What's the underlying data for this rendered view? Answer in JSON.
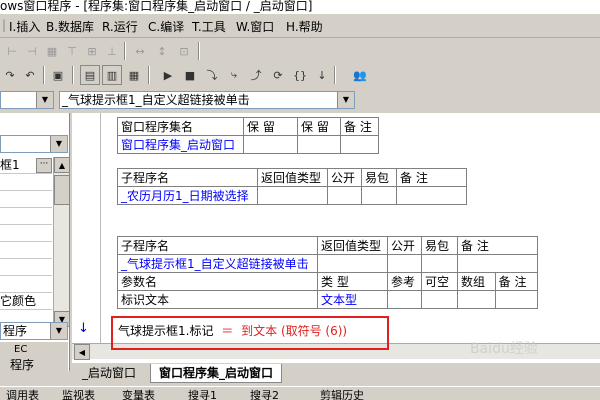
{
  "window": {
    "title": "ows窗口程序 - [程序集:窗口程序集_启动窗口 / _启动窗口]"
  },
  "menu": {
    "items": [
      "I.插入",
      "B.数据库",
      "R.运行",
      "C.编译",
      "T.工具",
      "W.窗口",
      "H.帮助"
    ]
  },
  "toolbar": {
    "combo_left": "",
    "combo_main": "_气球提示框1_自定义超链接被单击"
  },
  "left_panel": {
    "combo_top": "",
    "row_selected": "框1",
    "row_dots": "···",
    "row_color": "它颜色",
    "combo_bottom": "程序",
    "tab_ec": "EC",
    "tab_program": "程序"
  },
  "editor": {
    "table1": {
      "headers": [
        "窗口程序集名",
        "保 留",
        "保 留",
        "备 注"
      ],
      "row": [
        "窗口程序集_启动窗口",
        "",
        "",
        ""
      ]
    },
    "table2": {
      "headers": [
        "子程序名",
        "返回值类型",
        "公开",
        "易包",
        "备 注"
      ],
      "row": [
        "_农历月历1_日期被选择",
        "",
        "",
        "",
        ""
      ]
    },
    "table3": {
      "headers": [
        "子程序名",
        "返回值类型",
        "公开",
        "易包",
        "备 注"
      ],
      "row": [
        "_气球提示框1_自定义超链接被单击",
        "",
        "",
        "",
        ""
      ],
      "param_headers": [
        "参数名",
        "类 型",
        "参考",
        "可空",
        "数组",
        "备 注"
      ],
      "param_row": [
        "标识文本",
        "文本型",
        "",
        "",
        "",
        ""
      ]
    },
    "code": {
      "object": "气球提示框1.标记",
      "op": "＝",
      "expr": "到文本 (取符号 (6))"
    },
    "gutter_arrow": "↓"
  },
  "tabs": [
    "_启动窗口",
    "窗口程序集_启动窗口"
  ],
  "statusbar": {
    "items": [
      "调用表",
      "监视表",
      "变量表",
      "搜寻1",
      "搜寻2",
      "剪辑历史"
    ]
  },
  "watermark": "Baidu经验",
  "colors": {
    "highlight_red": "#e02020",
    "link_blue": "#0000ff"
  }
}
